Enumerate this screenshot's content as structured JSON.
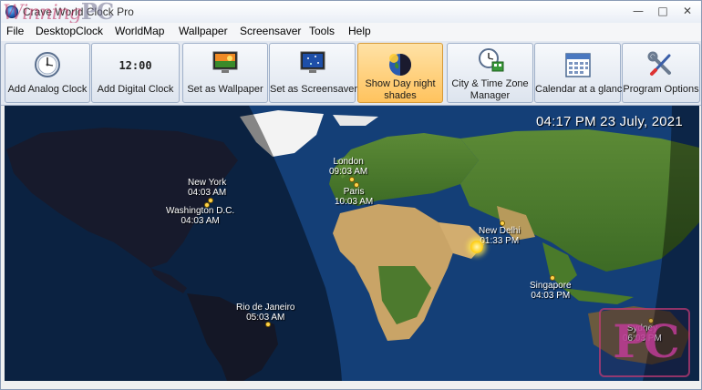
{
  "window": {
    "title": "Crave World Clock Pro",
    "watermark": "WinningPC",
    "controls": {
      "minimize": "—",
      "maximize": "□",
      "close": "✕"
    }
  },
  "menu": [
    "File",
    "DesktopClock",
    "WorldMap",
    "Wallpaper",
    "Screensaver",
    "Tools",
    "Help"
  ],
  "toolbar": {
    "add_analog": "Add Analog Clock",
    "add_digital": "Add Digital Clock",
    "digital_icon_text": "12:00",
    "set_wallpaper": "Set as Wallpaper",
    "set_screensaver": "Set as Screensaver",
    "show_day_night": "Show Day night shades",
    "city_tz_manager": "City & Time Zone Manager",
    "calendar": "Calendar at a glance",
    "options": "Program Options"
  },
  "map": {
    "datetime": "04:17 PM 23 July, 2021",
    "cities": [
      {
        "name": "London",
        "time": "09:03 AM"
      },
      {
        "name": "Paris",
        "time": "10:03 AM"
      },
      {
        "name": "New York",
        "time": "04:03 AM"
      },
      {
        "name": "Washington D.C.",
        "time": "04:03 AM"
      },
      {
        "name": "New Delhi",
        "time": "01:33 PM"
      },
      {
        "name": "Singapore",
        "time": "04:03 PM"
      },
      {
        "name": "Rio de Janeiro",
        "time": "05:03 AM"
      },
      {
        "name": "Sydney",
        "time": "06:03 PM"
      }
    ],
    "watermark": "PC"
  },
  "colors": {
    "ocean_day": "#143f77",
    "ocean_night": "#07182f",
    "land_day": "#4d7a2e",
    "desert": "#c9a467",
    "ice": "#f3f3f3",
    "night_land": "#2a2d4a",
    "active_button": "#ffc35e"
  }
}
